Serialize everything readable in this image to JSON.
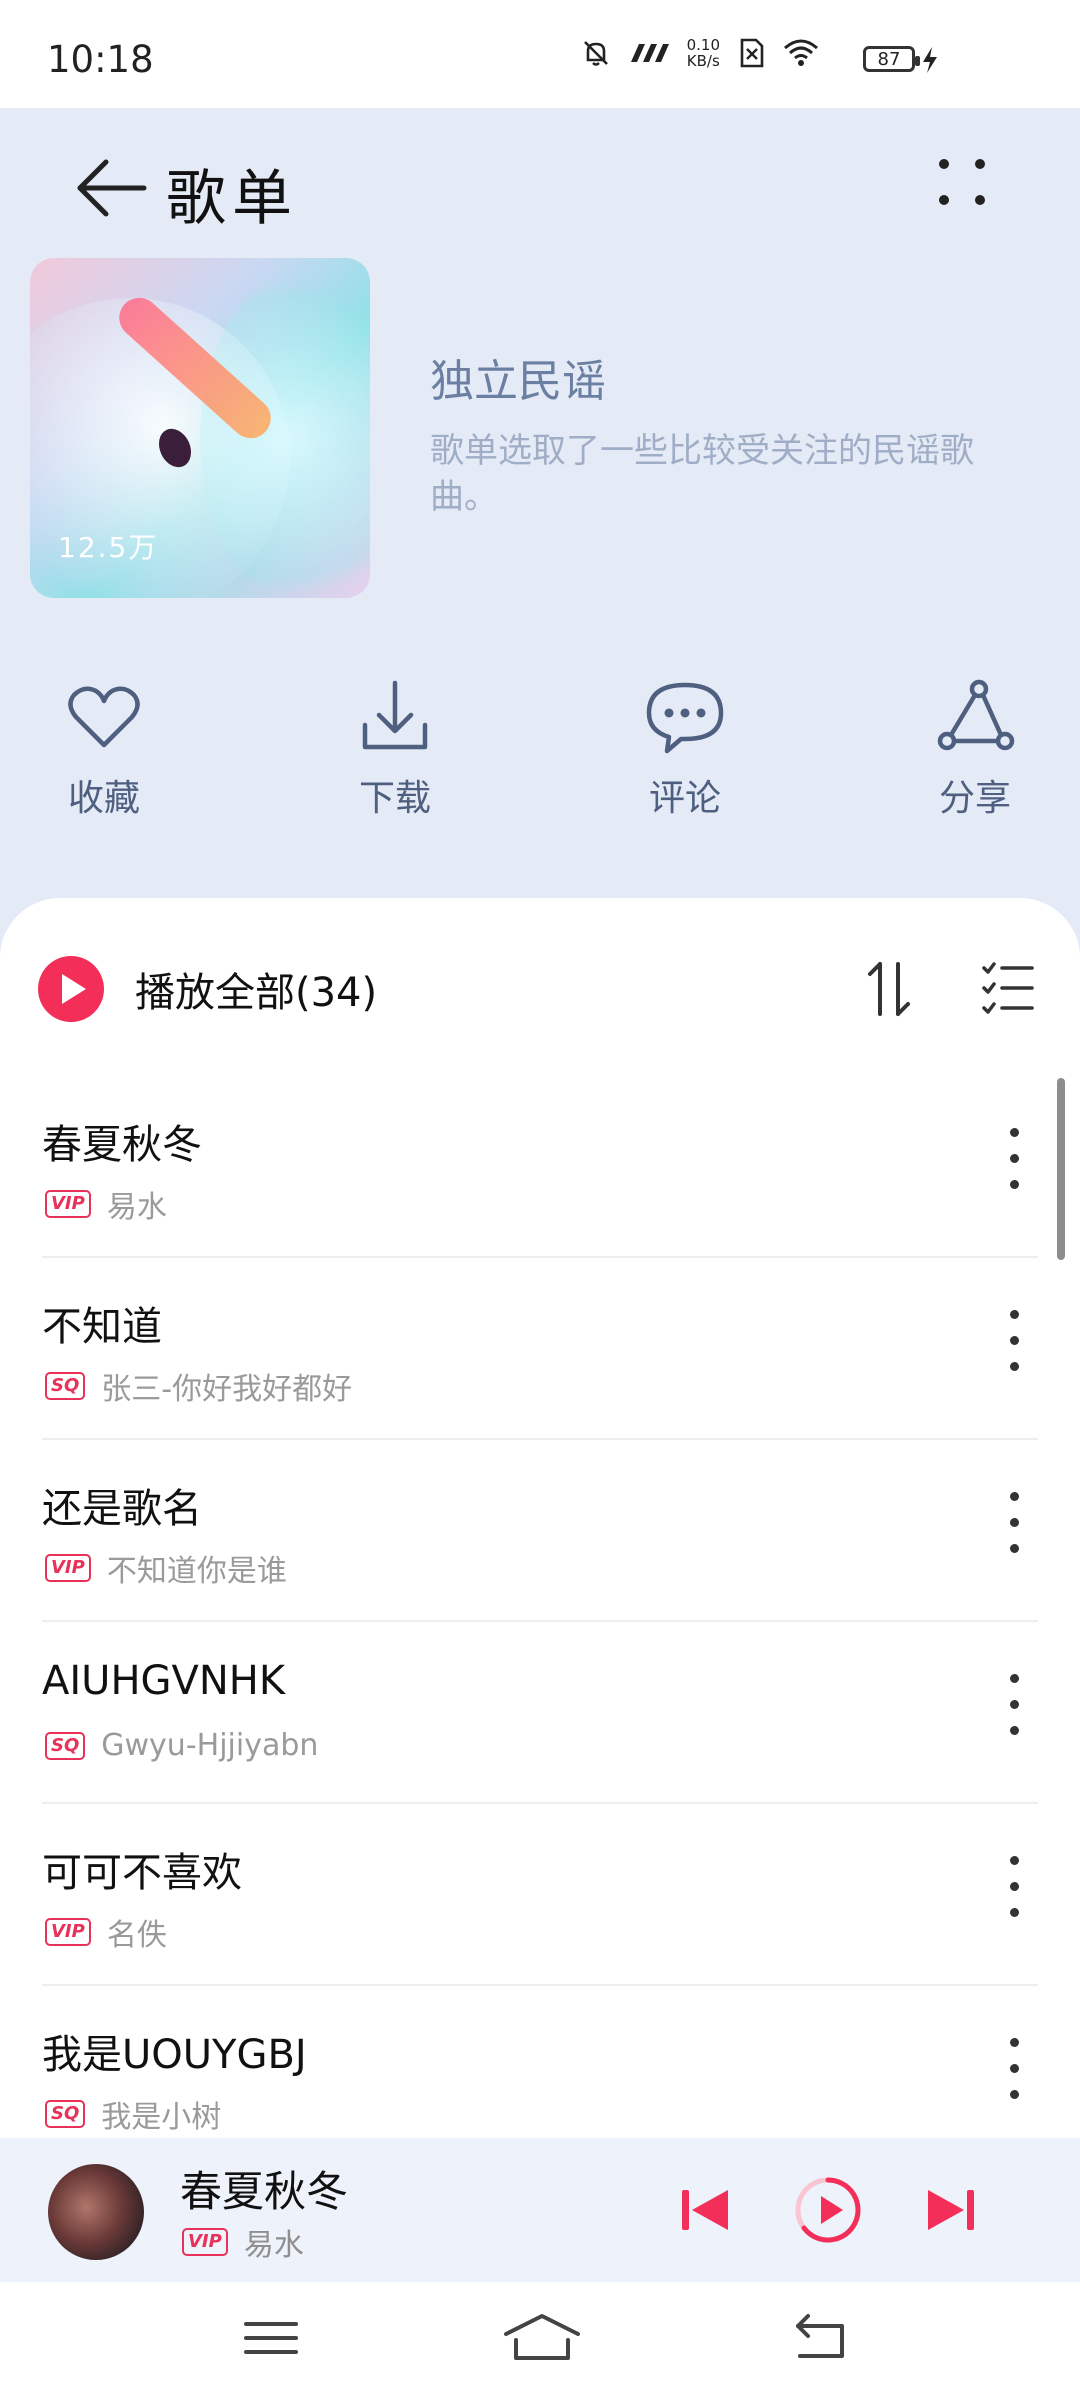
{
  "status_bar": {
    "time": "10:18",
    "net_speed_value": "0.10",
    "net_speed_unit": "KB/s",
    "battery": "87"
  },
  "header": {
    "title": "歌单",
    "back_icon": "arrow-left-icon",
    "more_icon": "four-dots-icon"
  },
  "playlist": {
    "play_count": "12.5万",
    "name": "独立民谣",
    "description": "歌单选取了一些比较受关注的民谣歌曲。"
  },
  "actions": [
    {
      "label": "收藏",
      "icon": "heart-icon"
    },
    {
      "label": "下载",
      "icon": "download-icon"
    },
    {
      "label": "评论",
      "icon": "comment-icon"
    },
    {
      "label": "分享",
      "icon": "share-icon"
    }
  ],
  "list": {
    "play_all_label": "播放全部(34)",
    "songs": [
      {
        "title": "春夏秋冬",
        "tag": "VIP",
        "artist": "易水"
      },
      {
        "title": "不知道",
        "tag": "SQ",
        "artist": "张三-你好我好都好"
      },
      {
        "title": "还是歌名",
        "tag": "VIP",
        "artist": "不知道你是谁"
      },
      {
        "title": "AIUHGVNHK",
        "tag": "SQ",
        "artist": "Gwyu-Hjjiyabn"
      },
      {
        "title": "可可不喜欢",
        "tag": "VIP",
        "artist": "名佚"
      },
      {
        "title": "我是UOUYGBJ",
        "tag": "SQ",
        "artist": "我是小树"
      }
    ]
  },
  "mini_player": {
    "title": "春夏秋冬",
    "tag": "VIP",
    "artist": "易水"
  },
  "colors": {
    "accent": "#f32e58",
    "header_bg": "#e4ebf6",
    "action_text": "#4e5f80"
  }
}
